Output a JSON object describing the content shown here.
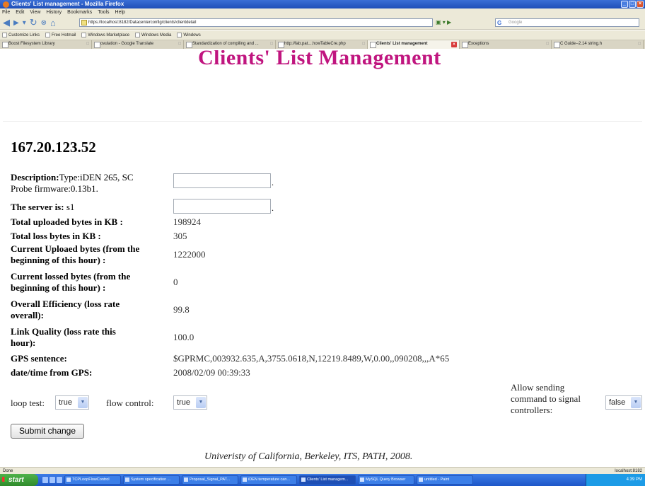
{
  "browser": {
    "window_title": "Clients' List management - Mozilla Firefox",
    "menu": [
      "File",
      "Edit",
      "View",
      "History",
      "Bookmarks",
      "Tools",
      "Help"
    ],
    "url": "https://localhost:8182/Datacenterconfig/clients/clientdetail",
    "search_placeholder": "Google",
    "bookmarks": [
      "Customize Links",
      "Free Hotmail",
      "Windows Marketplace",
      "Windows Media",
      "Windows"
    ],
    "tabs": [
      {
        "label": "Boost Filesystem Library",
        "active": false
      },
      {
        "label": "ovulation - Google Translate",
        "active": false
      },
      {
        "label": "Standardization of compiling and ...",
        "active": false
      },
      {
        "label": "http://fab.pat....howTableCre.php",
        "active": false
      },
      {
        "label": "Clients' List management",
        "active": true
      },
      {
        "label": "Exceptions",
        "active": false
      },
      {
        "label": "C Guide--2.14 string.h",
        "active": false
      }
    ],
    "status_left": "Done",
    "status_right": "localhost:8182"
  },
  "page": {
    "heading": "Clients' List Management",
    "ip": "167.20.123.52",
    "description_label": "Description:",
    "description_value_line1": "Type:iDEN 265, SC",
    "description_value_line2": "Probe firmware:0.13b1.",
    "server_label": "The server is:",
    "server_value": "s1",
    "total_uploaded_label": "Total uploaded bytes in KB :",
    "total_uploaded_value": "198924",
    "total_loss_label": "Total loss bytes in KB :",
    "total_loss_value": "305",
    "current_upload_label_1": "Current Uploaed bytes (from the",
    "current_upload_label_2": "beginning of this hour) :",
    "current_upload_value": "1222000",
    "current_lossed_label_1": "Current lossed bytes (from the",
    "current_lossed_label_2": "beginning of this hour) :",
    "current_lossed_value": "0",
    "efficiency_label_1": "Overall Efficiency (loss rate",
    "efficiency_label_2": "overall):",
    "efficiency_value": "99.8",
    "link_quality_label_1": "Link Quality (loss rate this",
    "link_quality_label_2": "hour):",
    "link_quality_value": "100.0",
    "gps_label": "GPS sentence:",
    "gps_value": "$GPRMC,003932.635,A,3755.0618,N,12219.8489,W,0.00,,090208,,,A*65",
    "gps_time_label": "date/time from GPS:",
    "gps_time_value": "2008/02/09 00:39:33",
    "loop_test_label": "loop test:",
    "loop_test_value": "true",
    "flow_control_label": "flow control:",
    "flow_control_value": "true",
    "allow_sending_label_1": "Allow sending",
    "allow_sending_label_2": "command to signal",
    "allow_sending_label_3": "controllers:",
    "allow_sending_value": "false",
    "submit_label": "Submit change",
    "footer": "Univeristy of California, Berkeley, ITS, PATH, 2008."
  },
  "taskbar": {
    "start_label": "start",
    "tasks": [
      {
        "label": "TCPLoopFlowControl",
        "active": false
      },
      {
        "label": "System specification ...",
        "active": false
      },
      {
        "label": "Proposal_Signal_PAT...",
        "active": false
      },
      {
        "label": "iDEN temperature can...",
        "active": false
      },
      {
        "label": "Clients' List managem...",
        "active": true
      },
      {
        "label": "MySQL Query Browser",
        "active": false
      },
      {
        "label": "untitled - Paint",
        "active": false
      }
    ],
    "clock": "4:39 PM"
  }
}
